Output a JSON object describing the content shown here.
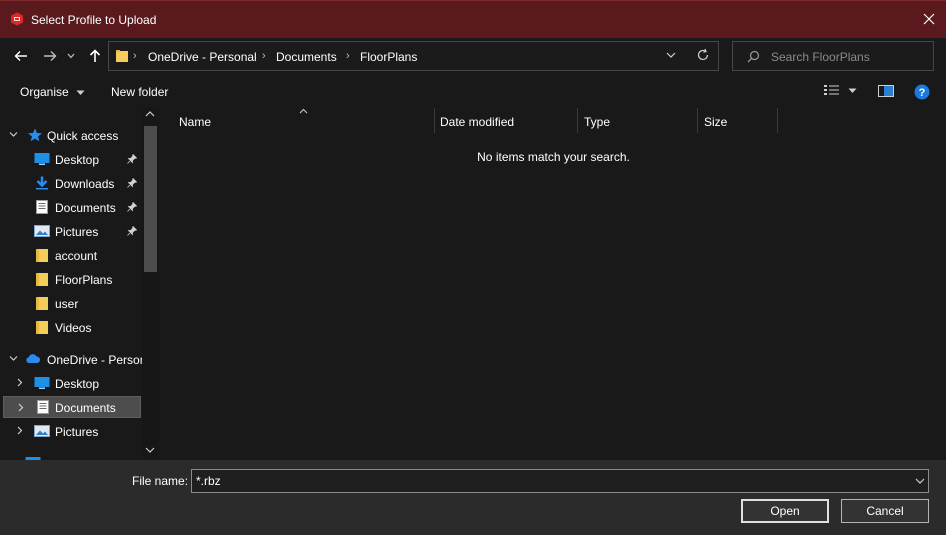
{
  "window": {
    "title": "Select Profile to Upload"
  },
  "address": {
    "crumbs": [
      "OneDrive - Personal",
      "Documents",
      "FloorPlans"
    ]
  },
  "search": {
    "placeholder": "Search FloorPlans"
  },
  "toolbar": {
    "organise_label": "Organise",
    "new_folder_label": "New folder"
  },
  "nav": {
    "quick_access": "Quick access",
    "items": [
      {
        "label": "Desktop",
        "icon": "desktop-icon",
        "pinned": true
      },
      {
        "label": "Downloads",
        "icon": "downloads-icon",
        "pinned": true
      },
      {
        "label": "Documents",
        "icon": "documents-icon",
        "pinned": true
      },
      {
        "label": "Pictures",
        "icon": "pictures-icon",
        "pinned": true
      },
      {
        "label": "account",
        "icon": "folder-icon",
        "pinned": false
      },
      {
        "label": "FloorPlans",
        "icon": "folder-icon",
        "pinned": false
      },
      {
        "label": "user",
        "icon": "folder-icon",
        "pinned": false
      },
      {
        "label": "Videos",
        "icon": "folder-icon",
        "pinned": false
      }
    ],
    "onedrive": "OneDrive - Persor",
    "onedrive_items": [
      {
        "label": "Desktop",
        "icon": "desktop-icon",
        "selected": false
      },
      {
        "label": "Documents",
        "icon": "documents-icon",
        "selected": true
      },
      {
        "label": "Pictures",
        "icon": "pictures-icon",
        "selected": false
      }
    ]
  },
  "columns": {
    "name": "Name",
    "date_modified": "Date modified",
    "type": "Type",
    "size": "Size"
  },
  "content": {
    "empty_message": "No items match your search."
  },
  "footer": {
    "file_name_label": "File name:",
    "file_name_value": "*.rbz",
    "open_label": "Open",
    "cancel_label": "Cancel"
  },
  "colors": {
    "titlebar": "#5a1a1d",
    "background": "#191919",
    "footer": "#2b2b2b",
    "help": "#1a7ae0"
  }
}
